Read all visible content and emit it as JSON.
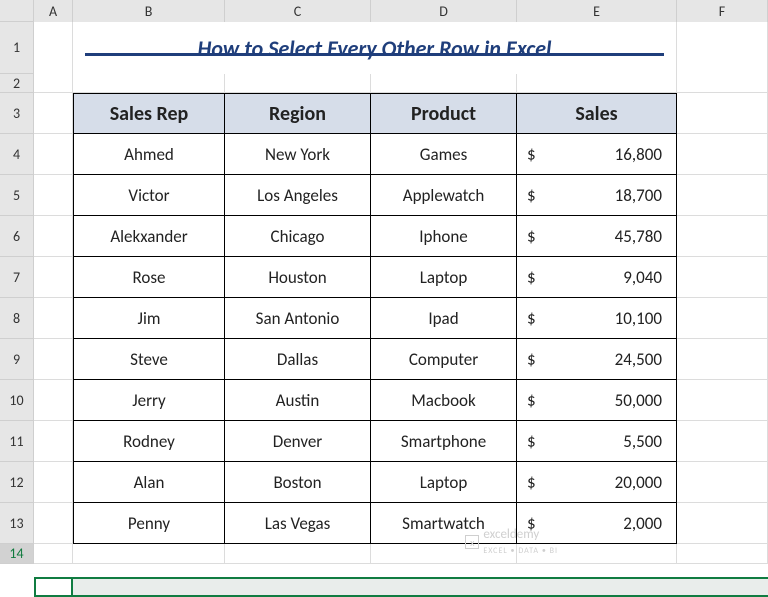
{
  "columns": [
    "A",
    "B",
    "C",
    "D",
    "E",
    "F"
  ],
  "rows": [
    "1",
    "2",
    "3",
    "4",
    "5",
    "6",
    "7",
    "8",
    "9",
    "10",
    "11",
    "12",
    "13",
    "14"
  ],
  "title": "How to Select Every Other Row in Excel",
  "headers": {
    "sales_rep": "Sales Rep",
    "region": "Region",
    "product": "Product",
    "sales": "Sales"
  },
  "data": [
    {
      "rep": "Ahmed",
      "region": "New York",
      "product": "Games",
      "sales": "16,800"
    },
    {
      "rep": "Victor",
      "region": "Los Angeles",
      "product": "Applewatch",
      "sales": "18,700"
    },
    {
      "rep": "Alekxander",
      "region": "Chicago",
      "product": "Iphone",
      "sales": "45,780"
    },
    {
      "rep": "Rose",
      "region": "Houston",
      "product": "Laptop",
      "sales": "9,040"
    },
    {
      "rep": "Jim",
      "region": "San Antonio",
      "product": "Ipad",
      "sales": "10,100"
    },
    {
      "rep": "Steve",
      "region": "Dallas",
      "product": "Computer",
      "sales": "24,500"
    },
    {
      "rep": "Jerry",
      "region": "Austin",
      "product": "Macbook",
      "sales": "50,000"
    },
    {
      "rep": "Rodney",
      "region": "Denver",
      "product": "Smartphone",
      "sales": "5,500"
    },
    {
      "rep": "Alan",
      "region": "Boston",
      "product": "Laptop",
      "sales": "20,000"
    },
    {
      "rep": "Penny",
      "region": "Las Vegas",
      "product": "Smartwatch",
      "sales": "2,000"
    }
  ],
  "currency_symbol": "$",
  "watermark": {
    "brand": "exceldemy",
    "tagline": "EXCEL • DATA • BI"
  },
  "chart_data": {
    "type": "table",
    "title": "How to Select Every Other Row in Excel",
    "columns": [
      "Sales Rep",
      "Region",
      "Product",
      "Sales"
    ],
    "rows": [
      [
        "Ahmed",
        "New York",
        "Games",
        16800
      ],
      [
        "Victor",
        "Los Angeles",
        "Applewatch",
        18700
      ],
      [
        "Alekxander",
        "Chicago",
        "Iphone",
        45780
      ],
      [
        "Rose",
        "Houston",
        "Laptop",
        9040
      ],
      [
        "Jim",
        "San Antonio",
        "Ipad",
        10100
      ],
      [
        "Steve",
        "Dallas",
        "Computer",
        24500
      ],
      [
        "Jerry",
        "Austin",
        "Macbook",
        50000
      ],
      [
        "Rodney",
        "Denver",
        "Smartphone",
        5500
      ],
      [
        "Alan",
        "Boston",
        "Laptop",
        20000
      ],
      [
        "Penny",
        "Las Vegas",
        "Smartwatch",
        2000
      ]
    ]
  }
}
